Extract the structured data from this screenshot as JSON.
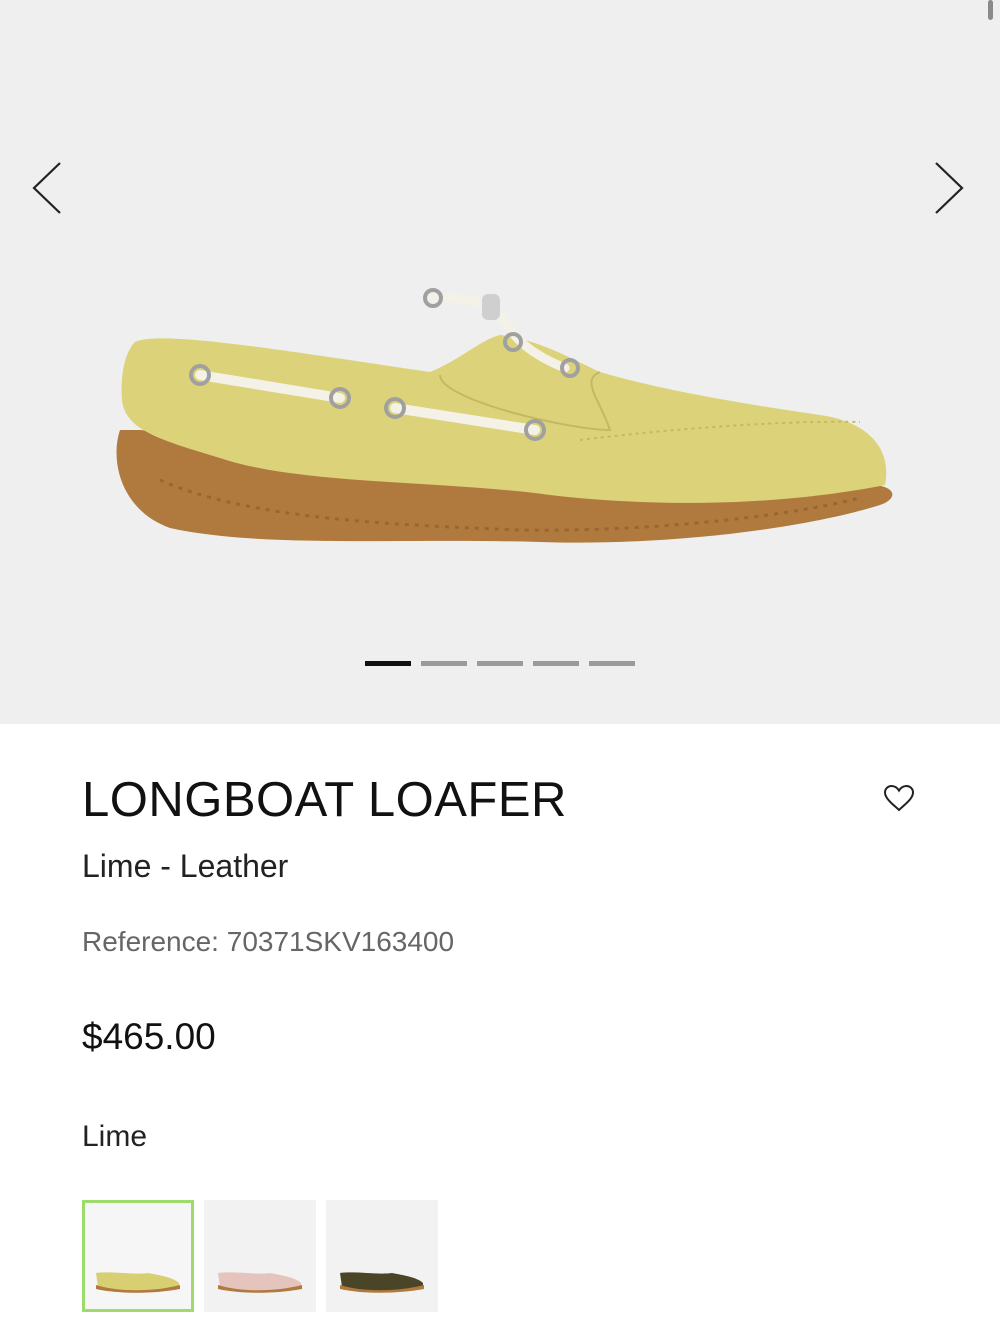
{
  "gallery": {
    "prev_icon": "chevron-left-icon",
    "next_icon": "chevron-right-icon",
    "image_alt": "loafer-side-view",
    "slide_count": 5,
    "active_slide": 1
  },
  "product": {
    "title": "LONGBOAT LOAFER",
    "subtitle": "Lime - Leather",
    "reference": "Reference: 70371SKV163400",
    "price": "$465.00",
    "color_label": "Lime",
    "wishlist_icon": "heart-outline-icon"
  },
  "colors": {
    "upper_lime": "#dcd27a",
    "sole_brown": "#b07a3e",
    "selected_border": "#9ddc6c"
  },
  "swatches": [
    {
      "name": "lime",
      "upper": "#d8cf72",
      "sole": "#b07a3e",
      "selected": true
    },
    {
      "name": "blush",
      "upper": "#e5c4bd",
      "sole": "#b07a3e",
      "selected": false
    },
    {
      "name": "olive",
      "upper": "#4a4526",
      "sole": "#b07a3e",
      "selected": false
    }
  ]
}
